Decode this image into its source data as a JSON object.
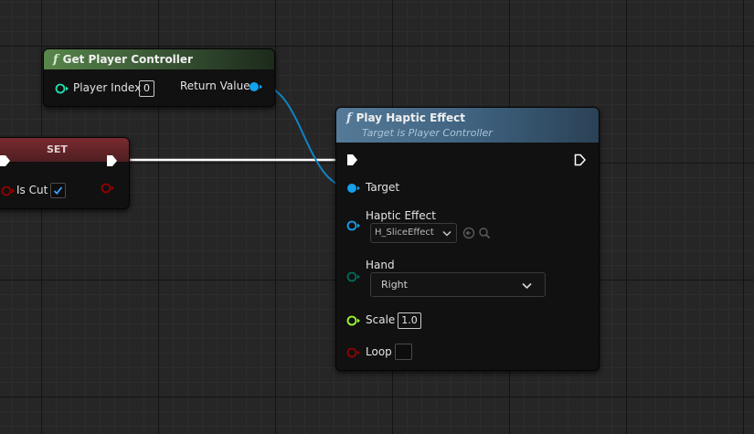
{
  "get_player_controller": {
    "title": "Get Player Controller",
    "player_index_label": "Player Index",
    "player_index_value": "0",
    "return_value_label": "Return Value"
  },
  "set_node": {
    "title": "SET",
    "is_cut_label": "Is Cut",
    "is_cut_checked": true
  },
  "play_haptic_effect": {
    "title": "Play Haptic Effect",
    "subtitle": "Target is Player Controller",
    "target_label": "Target",
    "haptic_effect_label": "Haptic Effect",
    "haptic_effect_value": "H_SliceEffect",
    "hand_label": "Hand",
    "hand_value": "Right",
    "scale_label": "Scale",
    "scale_value": "1.0",
    "loop_label": "Loop",
    "loop_checked": false
  },
  "colors": {
    "object_pin": "#14a1ee",
    "int_pin": "#1fe0ae",
    "bool_pin": "#950000",
    "float_pin": "#a0ff30",
    "byte_pin": "#006a5e",
    "function_header": "#4d6f90",
    "pure_header": "#4a7c3f",
    "set_header": "#6e2229"
  }
}
